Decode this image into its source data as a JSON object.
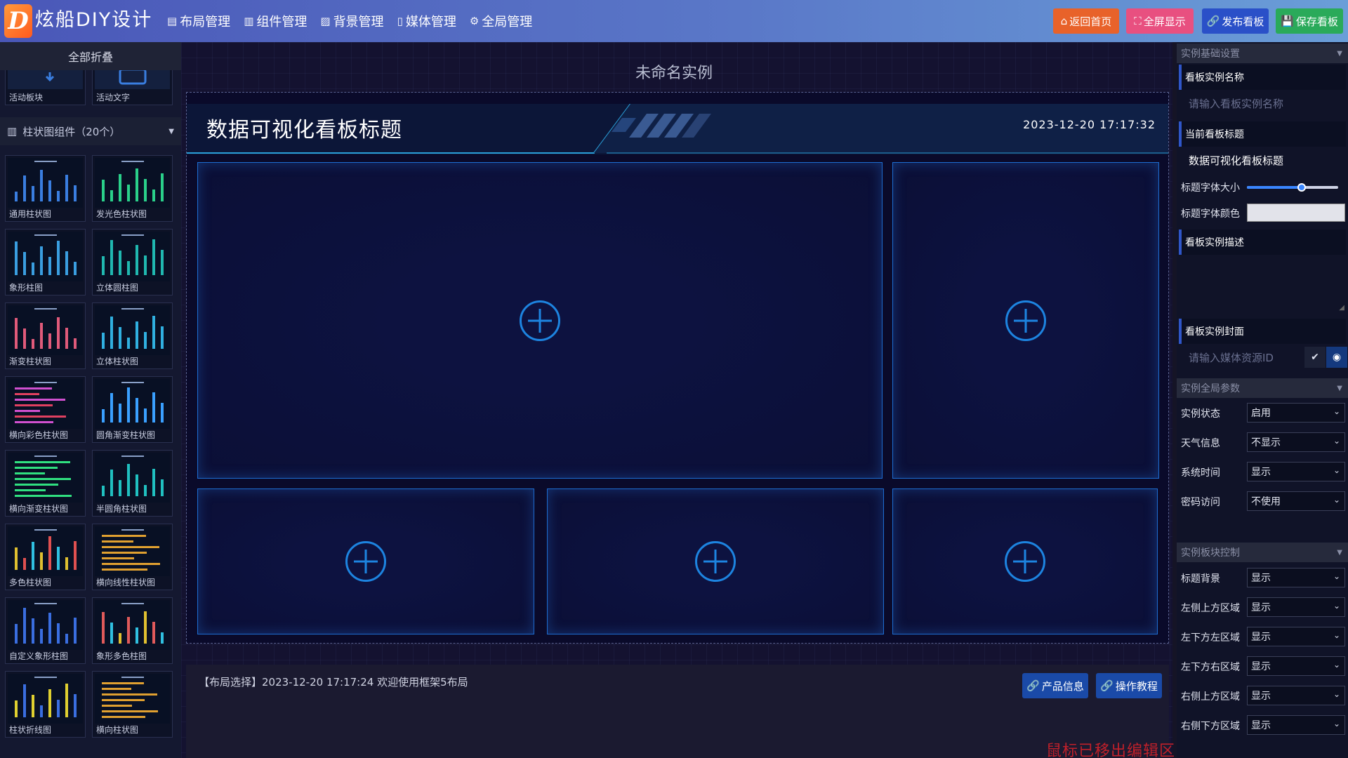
{
  "app": {
    "logo_letter": "D",
    "name": "炫船DIY设计"
  },
  "nav": [
    {
      "icon": "layout-icon",
      "glyph": "▤",
      "label": "布局管理"
    },
    {
      "icon": "bar-chart-icon",
      "glyph": "▥",
      "label": "组件管理"
    },
    {
      "icon": "image-icon",
      "glyph": "▨",
      "label": "背景管理"
    },
    {
      "icon": "file-icon",
      "glyph": "▯",
      "label": "媒体管理"
    },
    {
      "icon": "gear-icon",
      "glyph": "⚙",
      "label": "全局管理"
    }
  ],
  "toolbar": {
    "home": {
      "label": "返回首页",
      "glyph": "⌂",
      "color": "#e8622a"
    },
    "fullscreen": {
      "label": "全屏显示",
      "glyph": "⛶",
      "color": "#e85080"
    },
    "publish": {
      "label": "发布看板",
      "glyph": "🔗",
      "color": "#2a50c8"
    },
    "save": {
      "label": "保存看板",
      "glyph": "💾",
      "color": "#2aaa5a"
    }
  },
  "left": {
    "collapse_all": "全部折叠",
    "top_tiles": [
      "活动板块",
      "活动文字"
    ],
    "group_title": "柱状图组件（20个）",
    "tiles": [
      "通用柱状图",
      "发光色柱状图",
      "象形柱图",
      "立体圆柱图",
      "渐变柱状图",
      "立体柱状图",
      "横向彩色柱状图",
      "圆角渐变柱状图",
      "横向渐变柱状图",
      "半圆角柱状图",
      "多色柱状图",
      "横向线性柱状图",
      "自定义象形柱图",
      "象形多色柱图",
      "柱状折线图",
      "横向柱状图"
    ]
  },
  "canvas": {
    "instance_title": "未命名实例",
    "board_title": "数据可视化看板标题",
    "board_time": "2023-12-20 17:17:32"
  },
  "status": {
    "text": "【布局选择】2023-12-20 17:17:24 欢迎使用框架5布局",
    "product_btn": "产品信息",
    "tutorial_btn": "操作教程",
    "mouse_hint": "鼠标已移出编辑区"
  },
  "right": {
    "basic_section": "实例基础设置",
    "name_label": "看板实例名称",
    "name_placeholder": "请输入看板实例名称",
    "board_title_label": "当前看板标题",
    "board_title_value": "数据可视化看板标题",
    "font_size_label": "标题字体大小",
    "font_size_fraction": 0.6,
    "font_color_label": "标题字体颜色",
    "font_color": "#e2e3ea",
    "desc_label": "看板实例描述",
    "cover_label": "看板实例封面",
    "cover_placeholder": "请输入媒体资源ID",
    "global_section": "实例全局参数",
    "global_rows": [
      {
        "label": "实例状态",
        "value": "启用"
      },
      {
        "label": "天气信息",
        "value": "不显示"
      },
      {
        "label": "系统时间",
        "value": "显示"
      },
      {
        "label": "密码访问",
        "value": "不使用"
      }
    ],
    "block_section": "实例板块控制",
    "block_rows": [
      {
        "label": "标题背景",
        "value": "显示"
      },
      {
        "label": "左侧上方区域",
        "value": "显示"
      },
      {
        "label": "左下方左区域",
        "value": "显示"
      },
      {
        "label": "左下方右区域",
        "value": "显示"
      },
      {
        "label": "右侧上方区域",
        "value": "显示"
      },
      {
        "label": "右侧下方区域",
        "value": "显示"
      }
    ]
  }
}
